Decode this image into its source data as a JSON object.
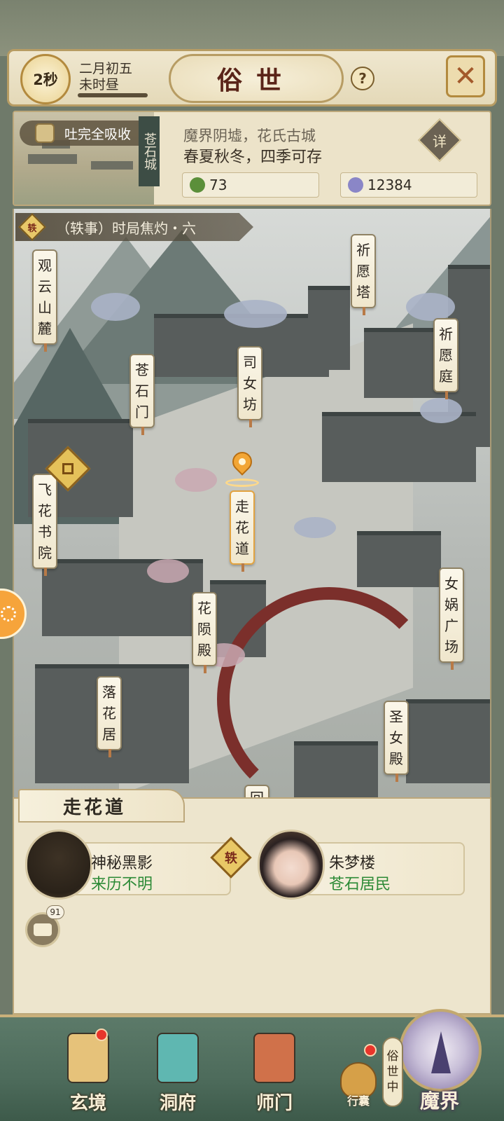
{
  "header": {
    "timer": "2秒",
    "date_line1": "二月初五",
    "date_line2": "未时昼",
    "time_progress": 1.0,
    "title": "俗世",
    "help": "?"
  },
  "info": {
    "absorb": "吐完全吸收",
    "city_banner": "苍石城",
    "line1": "魔界阴墟，花氏古城",
    "line2": "春夏秋冬，四季可存",
    "detail": "详",
    "resource_green": "73",
    "resource_coin": "12384"
  },
  "quest": {
    "badge": "轶",
    "text": "（轶事）时局焦灼・六"
  },
  "locations": [
    {
      "id": "guanyun",
      "label": "观云山麓"
    },
    {
      "id": "qiyuanta",
      "label": "祈愿塔"
    },
    {
      "id": "qiyuanting",
      "label": "祈愿庭"
    },
    {
      "id": "cangshimen",
      "label": "苍石门"
    },
    {
      "id": "sinvfang",
      "label": "司女坊"
    },
    {
      "id": "feihua",
      "label": "飞花书院"
    },
    {
      "id": "zouhuadao",
      "label": "走花道"
    },
    {
      "id": "nvwa",
      "label": "女娲广场"
    },
    {
      "id": "huayun",
      "label": "花陨殿"
    },
    {
      "id": "luohua",
      "label": "落花居"
    },
    {
      "id": "shengnv",
      "label": "圣女殿"
    },
    {
      "id": "hui",
      "label": "回"
    }
  ],
  "current_place": "走花道",
  "characters": [
    {
      "name": "神秘黑影",
      "desc": "来历不明",
      "badge": "轶"
    },
    {
      "name": "朱梦楼",
      "desc": "苍石居民"
    }
  ],
  "chat_count": "91",
  "nav": {
    "xuanjing": "玄境",
    "dongfu": "洞府",
    "shimen": "师门",
    "bag": "行囊",
    "realm_status": "俗世中",
    "realm": "魔界"
  },
  "colors": {
    "accent": "#5a2418",
    "green_text": "#2c8a36",
    "red_dot": "#e8352b"
  }
}
